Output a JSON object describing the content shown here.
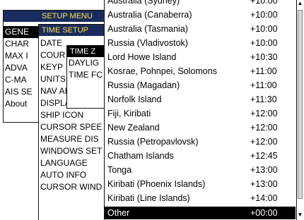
{
  "setup_menu": {
    "title": "SETUP MENU",
    "items": [
      "GENE",
      "CHAR",
      "MAX I",
      "ADVA",
      "C-MA",
      "AIS SE",
      "About"
    ]
  },
  "time_setup": {
    "title": "TIME SETUP",
    "items": [
      "DATE",
      "COUR",
      "KEYP",
      "UNITS",
      "NAV AIDS PRI",
      "DISPLAY COLO",
      "SHIP ICON",
      "CURSOR SPEE",
      "MEASURE DIS",
      "WINDOWS SET",
      "LANGUAGE",
      "AUTO INFO",
      "CURSOR WIND"
    ]
  },
  "time_zone": {
    "title": "TIME Z",
    "items": [
      "DAYLIG",
      "TIME FC"
    ]
  },
  "timezones": [
    {
      "name": "Australia (Sydney)",
      "offset": "+10:00"
    },
    {
      "name": "Australia (Canaberra)",
      "offset": "+10:00"
    },
    {
      "name": "Australia (Tasmania)",
      "offset": "+10:00"
    },
    {
      "name": "Russia (Vladivostok)",
      "offset": "+10:00"
    },
    {
      "name": "Lord Howe Island",
      "offset": "+10:30"
    },
    {
      "name": "Kosrae, Pohnpei, Solomons",
      "offset": "+11:00"
    },
    {
      "name": "Russia (Magadan)",
      "offset": "+11:00"
    },
    {
      "name": "Norfolk Island",
      "offset": "+11:30"
    },
    {
      "name": "Fiji, Kiribati",
      "offset": "+12:00"
    },
    {
      "name": "New Zealand",
      "offset": "+12:00"
    },
    {
      "name": "Russia (Petropavlovsk)",
      "offset": "+12:00"
    },
    {
      "name": "Chatham Islands",
      "offset": "+12:45"
    },
    {
      "name": "Tonga",
      "offset": "+13:00"
    },
    {
      "name": "Kiribati (Phoenix Islands)",
      "offset": "+13:00"
    },
    {
      "name": "Kiribati (Line Islands)",
      "offset": "+14:00"
    }
  ],
  "selected_timezone": {
    "name": "Other",
    "offset": "+00:00"
  },
  "colors": {
    "title_bar": "#1a2c5e",
    "title_text": "#ffe24a",
    "selection": "#000000"
  }
}
